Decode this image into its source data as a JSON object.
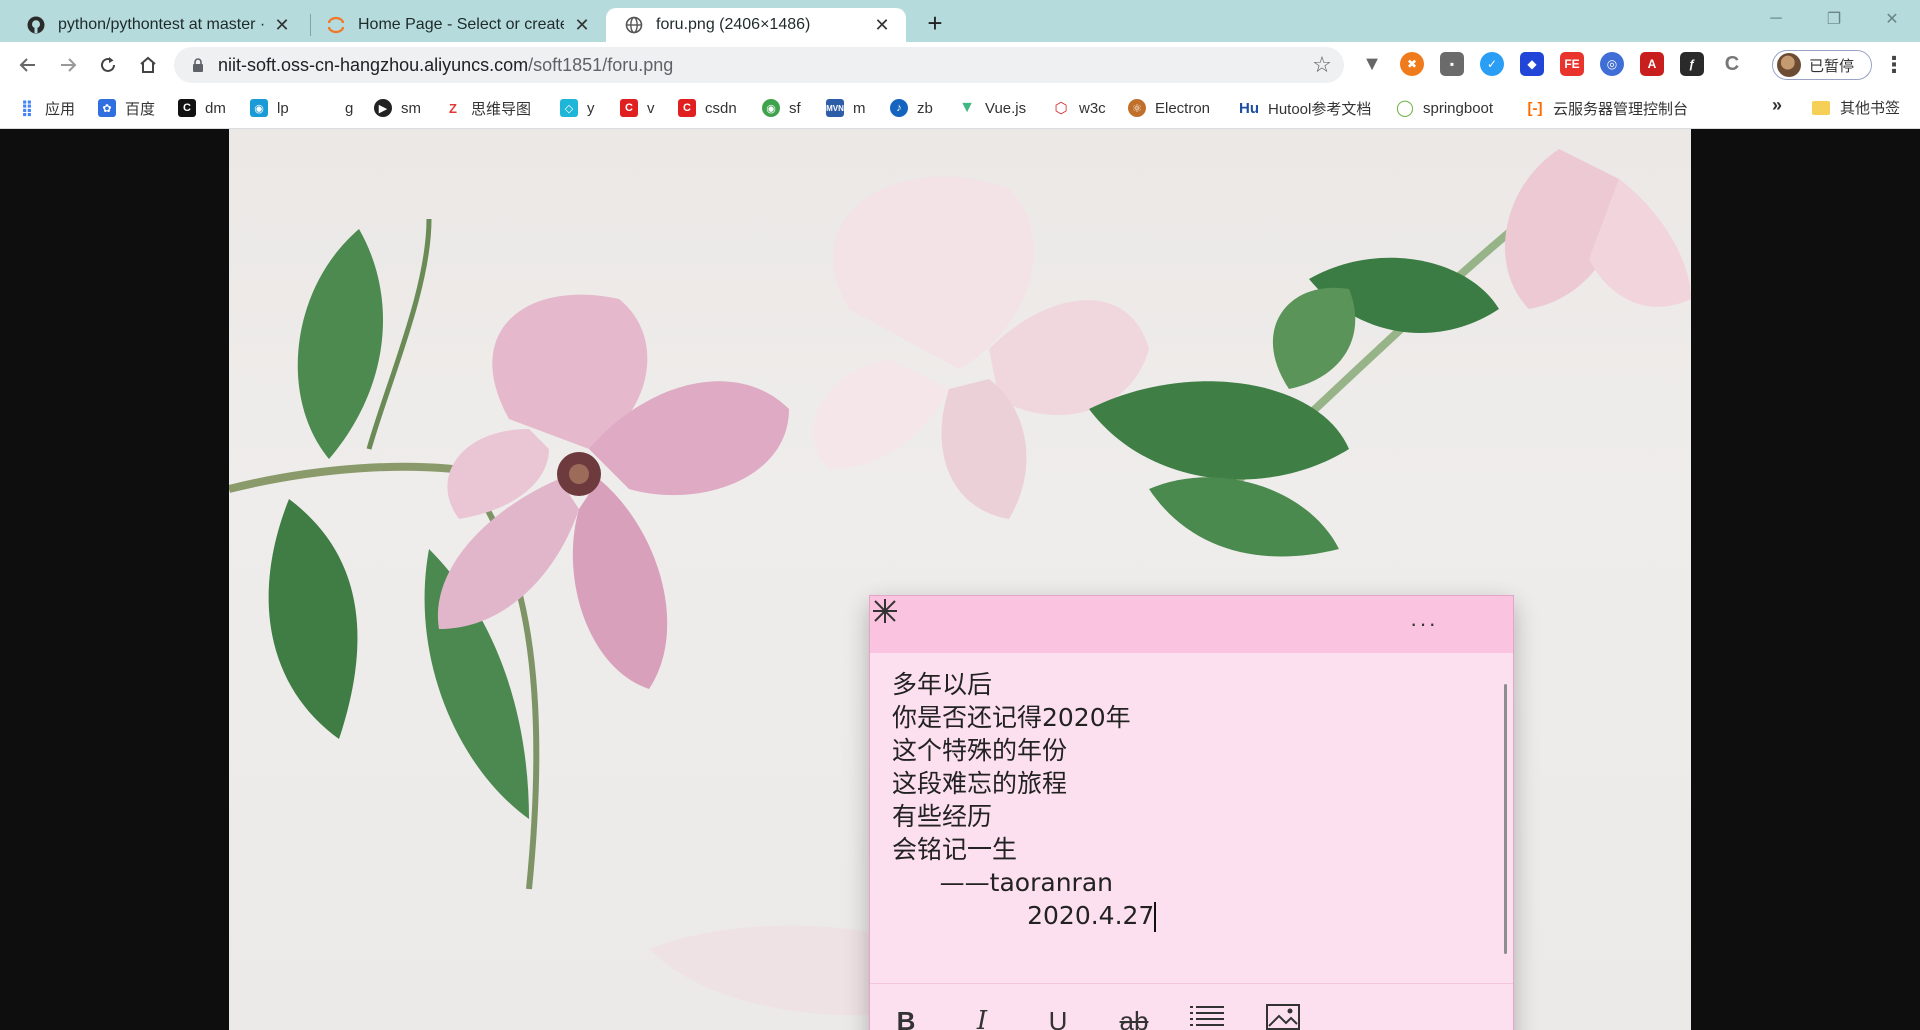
{
  "tabs": [
    {
      "title": "python/pythontest at master · ",
      "icon": "github-icon",
      "active": false
    },
    {
      "title": "Home Page - Select or create a",
      "icon": "jupyter-icon",
      "active": false
    },
    {
      "title": "foru.png (2406×1486)",
      "icon": "globe-icon",
      "active": true
    }
  ],
  "toolbar": {
    "url_host": "niit-soft.oss-cn-hangzhou.aliyuncs.com",
    "url_path": "/soft1851/foru.png",
    "profile_label": "已暂停"
  },
  "bookmarks": [
    {
      "label": "应用",
      "icon": "apps-grid-icon",
      "color": "#4285f4"
    },
    {
      "label": "百度",
      "icon": "baidu-paw-icon",
      "color": "#2f6fe0"
    },
    {
      "label": "dm",
      "icon": "dm-icon",
      "color": "#111111"
    },
    {
      "label": "lp",
      "icon": "lp-icon",
      "color": "#1a9ad6"
    },
    {
      "label": "g",
      "icon": "g-icon",
      "color": "#dddddd"
    },
    {
      "label": "sm",
      "icon": "sm-icon",
      "color": "#222222"
    },
    {
      "label": "思维导图",
      "icon": "mindmap-icon",
      "color": "#e53935"
    },
    {
      "label": "y",
      "icon": "y-icon",
      "color": "#1db5d8"
    },
    {
      "label": "v",
      "icon": "v-icon",
      "color": "#e02020"
    },
    {
      "label": "csdn",
      "icon": "csdn-icon",
      "color": "#e02020"
    },
    {
      "label": "sf",
      "icon": "sf-icon",
      "color": "#3fa34d"
    },
    {
      "label": "m",
      "icon": "mvn-icon",
      "color": "#2d5ca8"
    },
    {
      "label": "zb",
      "icon": "zb-icon",
      "color": "#1565c0"
    },
    {
      "label": "Vue.js",
      "icon": "vue-icon",
      "color": "#41b883"
    },
    {
      "label": "w3c",
      "icon": "w3c-icon",
      "color": "#d32f2f"
    },
    {
      "label": "Electron",
      "icon": "electron-icon",
      "color": "#c0702a"
    },
    {
      "label": "Hutool参考文档",
      "icon": "hutool-icon",
      "color": "#1e4fa3"
    },
    {
      "label": "springboot",
      "icon": "springboot-icon",
      "color": "#6db33f"
    },
    {
      "label": "云服务器管理控制台",
      "icon": "aliyun-icon",
      "color": "#ff6a00"
    }
  ],
  "bookmarks_other": "其他书签",
  "note": {
    "lines": [
      "多年以后",
      "你是否还记得2020年",
      "这个特殊的年份",
      "这段难忘的旅程",
      "有些经历",
      "会铭记一生",
      "      ——taoranran",
      "                 2020.4.27"
    ],
    "colors": {
      "header": "#fac3df",
      "body": "#fde0ef"
    }
  }
}
